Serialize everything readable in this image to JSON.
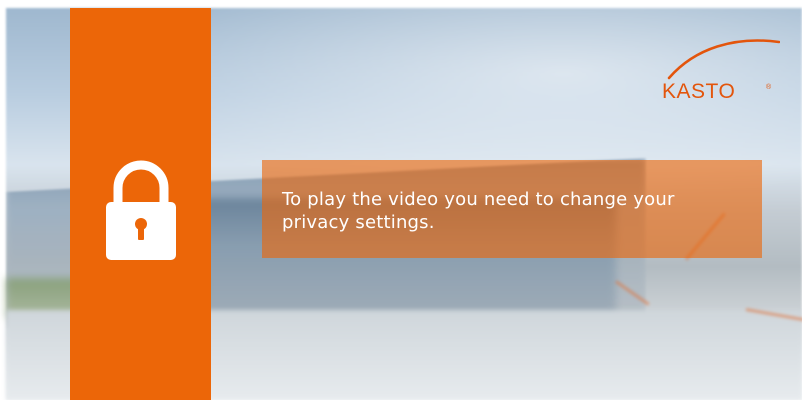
{
  "privacy_notice": {
    "message": "To play the video you need to change your privacy settings."
  },
  "brand": {
    "logo_text": "KASTO",
    "registered_mark": "®"
  },
  "icons": {
    "lock": "lock-icon",
    "logo_swoosh": "logo-swoosh-icon"
  },
  "colors": {
    "accent_orange": "#ec6608",
    "logo_orange": "#e3550c",
    "text_on_accent": "#ffffff"
  }
}
